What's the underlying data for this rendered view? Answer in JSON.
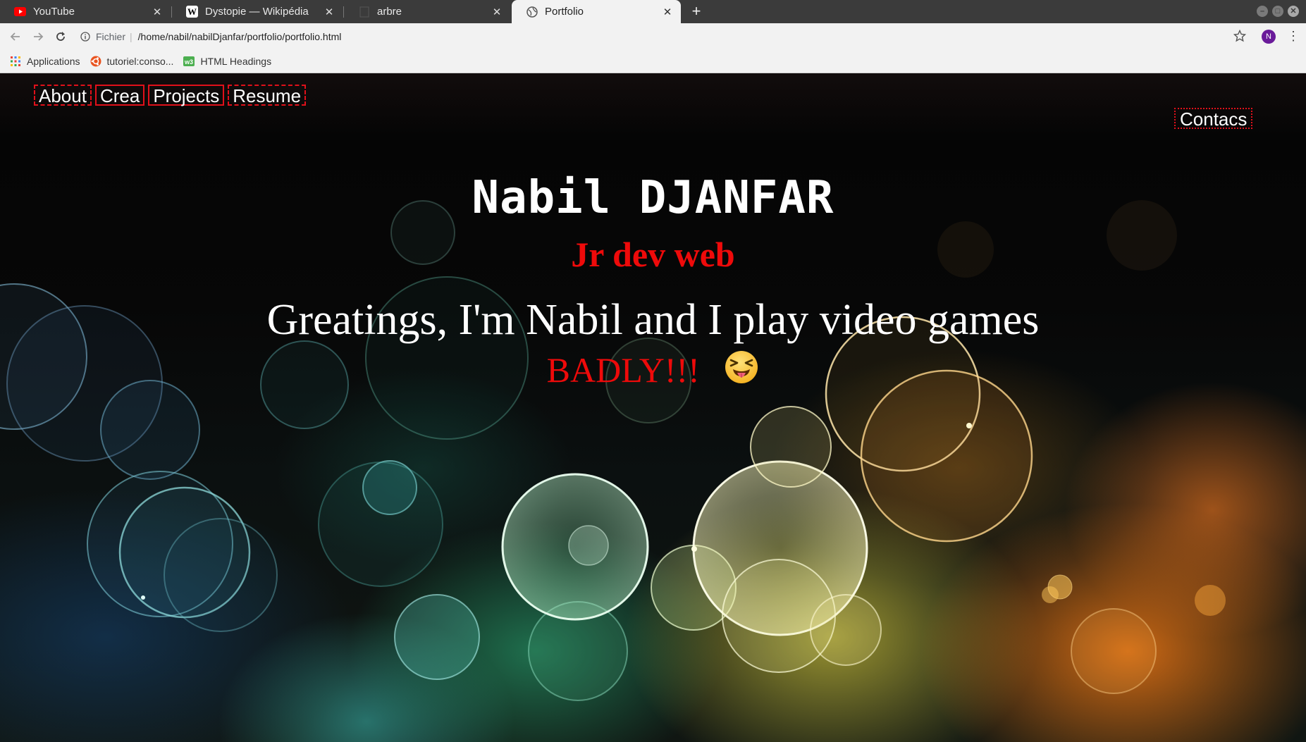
{
  "browser": {
    "tabs": [
      {
        "title": "YouTube",
        "icon": "youtube-icon",
        "active": false
      },
      {
        "title": "Dystopie — Wikipédia",
        "icon": "wikipedia-icon",
        "active": false
      },
      {
        "title": "arbre",
        "icon": "blank-page-icon",
        "active": false
      },
      {
        "title": "Portfolio",
        "icon": "globe-icon",
        "active": true
      }
    ],
    "address": {
      "scheme_label": "Fichier",
      "url": "/home/nabil/nabilDjanfar/portfolio/portfolio.html"
    },
    "profile_initial": "N",
    "bookmarks": [
      {
        "label": "Applications",
        "icon": "apps-grid-icon"
      },
      {
        "label": "tutoriel:conso...",
        "icon": "ubuntu-icon"
      },
      {
        "label": "HTML Headings",
        "icon": "w3schools-icon"
      }
    ]
  },
  "page": {
    "nav": [
      {
        "label": "About",
        "style": "dashed"
      },
      {
        "label": "Crea",
        "style": "solid"
      },
      {
        "label": "Projects",
        "style": "solid"
      },
      {
        "label": "Resume",
        "style": "dashed"
      }
    ],
    "contact_label": "Contacs",
    "name": "Nabil DJANFAR",
    "role": "Jr dev web",
    "greeting": "Greatings, I'm Nabil and I play video games",
    "badly": "BADLY!!!",
    "emoji": "squinting-face-with-tongue-icon",
    "colors": {
      "accent_red": "#ee0a0a",
      "nav_border_red": "#e0101a",
      "text_white": "#ffffff"
    }
  }
}
